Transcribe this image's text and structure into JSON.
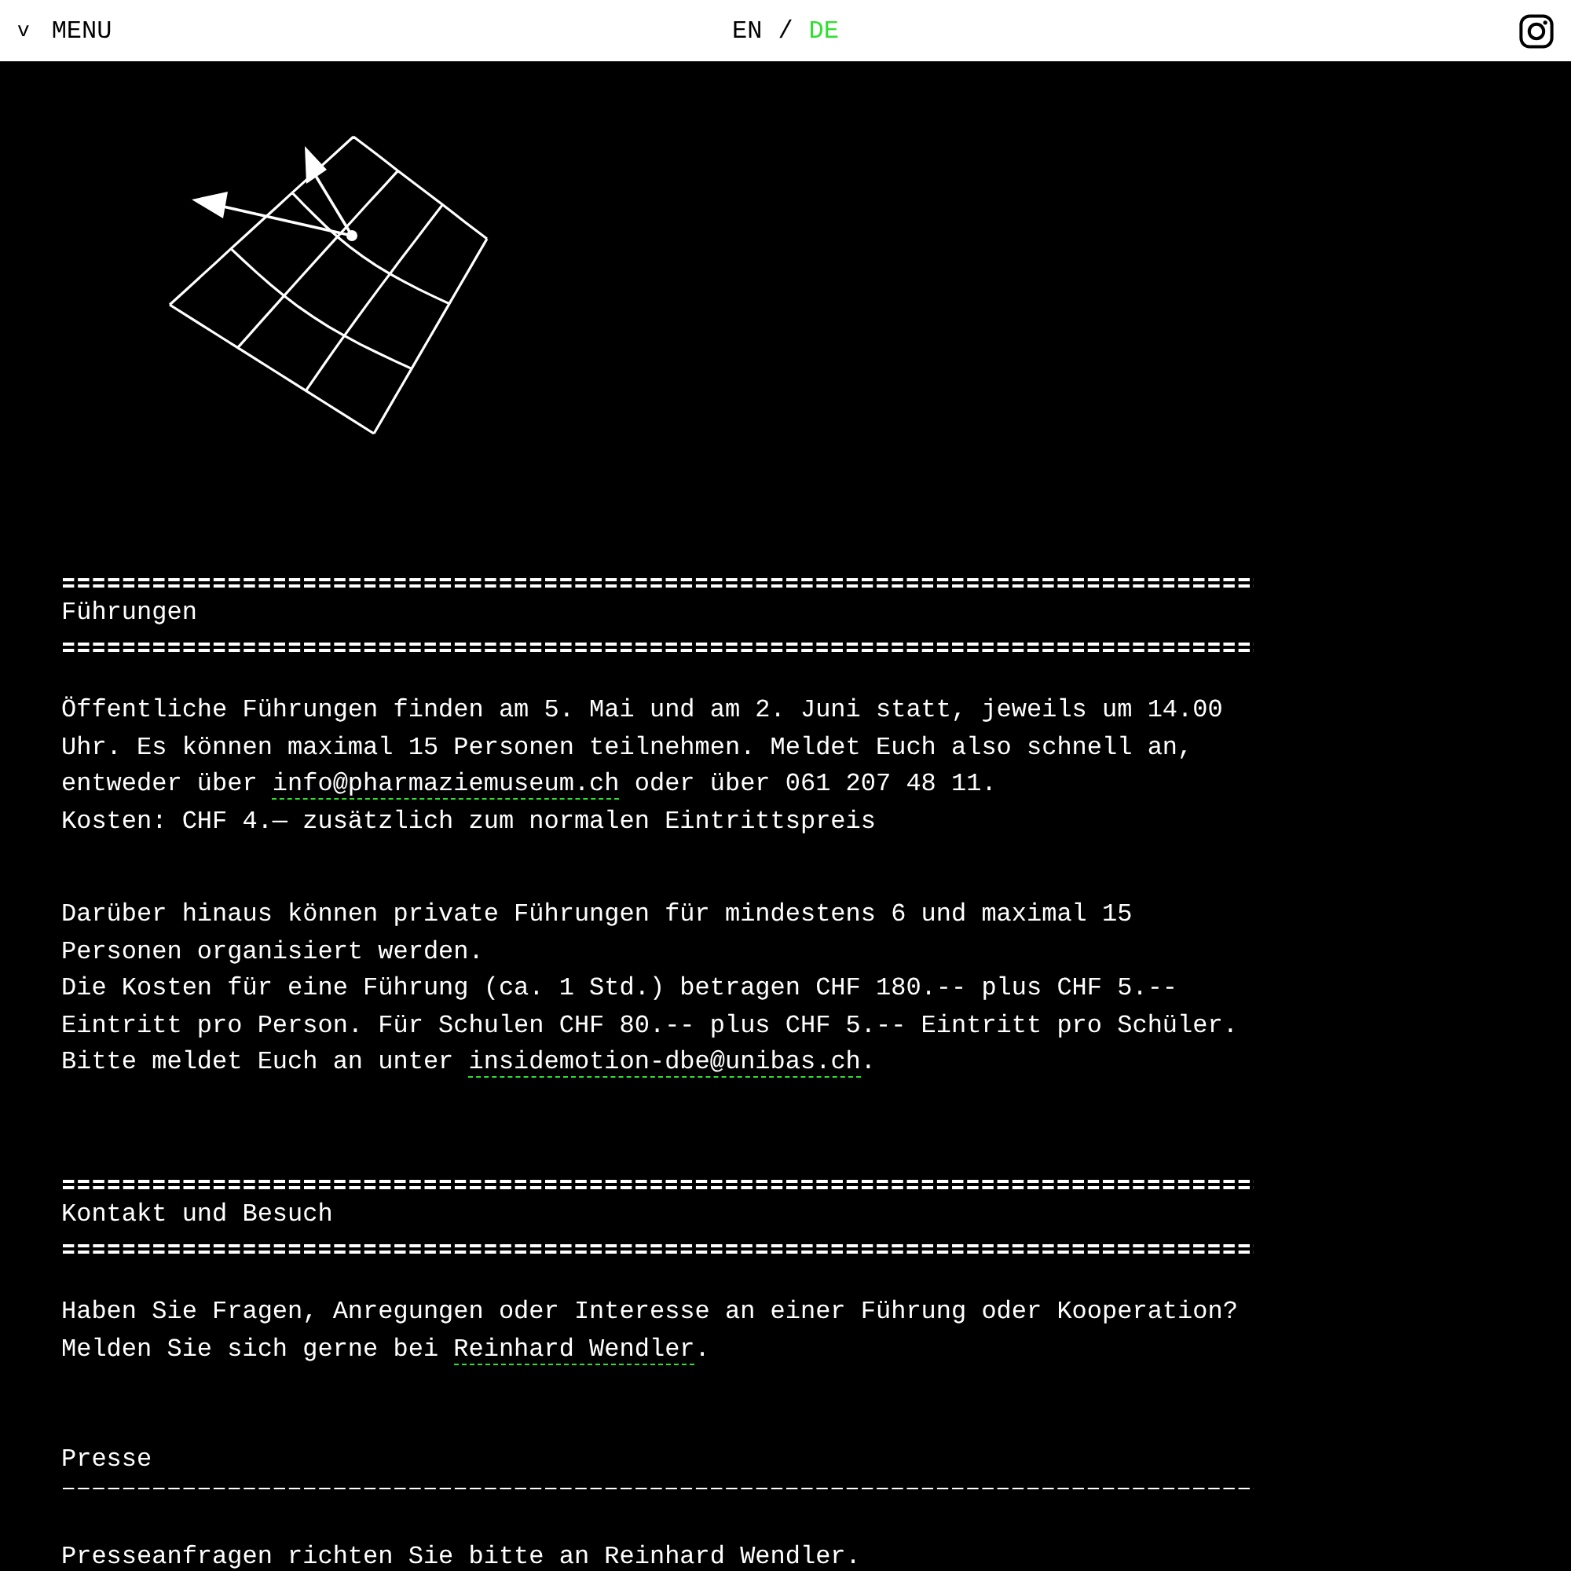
{
  "header": {
    "menu": {
      "caret": "v",
      "label": "MENU"
    },
    "languages": [
      {
        "label": "EN",
        "selected": false
      },
      {
        "label": "DE",
        "selected": true
      }
    ],
    "language_separator": "/"
  },
  "sections": [
    {
      "kind": "major",
      "heading": "Führungen",
      "paragraphs": [
        {
          "lines": [
            [
              {
                "kind": "text",
                "text": "Öffentliche Führungen finden am 5. Mai und am 2. Juni statt, jeweils um 14.00 Uhr. Es können maximal 15 Personen teilnehmen. Meldet Euch also schnell an, entweder über "
              },
              {
                "kind": "link",
                "text": "info@pharmaziemuseum.ch"
              },
              {
                "kind": "text",
                "text": " oder über 061 207 48 11."
              }
            ],
            [
              {
                "kind": "text",
                "text": "Kosten: CHF 4.— zusätzlich zum normalen Eintrittspreis"
              }
            ]
          ]
        },
        {
          "lines": [
            [
              {
                "kind": "text",
                "text": "Darüber hinaus können private Führungen für mindestens 6 und maximal 15 Personen organisiert werden."
              }
            ],
            [
              {
                "kind": "text",
                "text": "Die Kosten für eine Führung (ca. 1 Std.) betragen CHF 180.-- plus CHF 5.-- Eintritt pro Person. Für Schulen CHF 80.-- plus CHF 5.-- Eintritt pro Schüler."
              }
            ],
            [
              {
                "kind": "text",
                "text": "Bitte meldet Euch an unter "
              },
              {
                "kind": "link",
                "text": "insidemotion-dbe@unibas.ch"
              },
              {
                "kind": "text",
                "text": "."
              }
            ]
          ]
        }
      ]
    },
    {
      "kind": "major",
      "heading": "Kontakt und Besuch",
      "paragraphs": [
        {
          "lines": [
            [
              {
                "kind": "text",
                "text": "Haben Sie Fragen, Anregungen oder Interesse an einer Führung oder Kooperation?"
              }
            ],
            [
              {
                "kind": "text",
                "text": "Melden Sie sich gerne bei "
              },
              {
                "kind": "link",
                "text": "Reinhard Wendler"
              },
              {
                "kind": "text",
                "text": "."
              }
            ]
          ]
        }
      ]
    },
    {
      "kind": "minor",
      "heading": "Presse",
      "paragraphs": [
        {
          "lines": [
            [
              {
                "kind": "text",
                "text": "Presseanfragen richten Sie bitte an Reinhard Wendler."
              }
            ]
          ]
        }
      ]
    }
  ]
}
